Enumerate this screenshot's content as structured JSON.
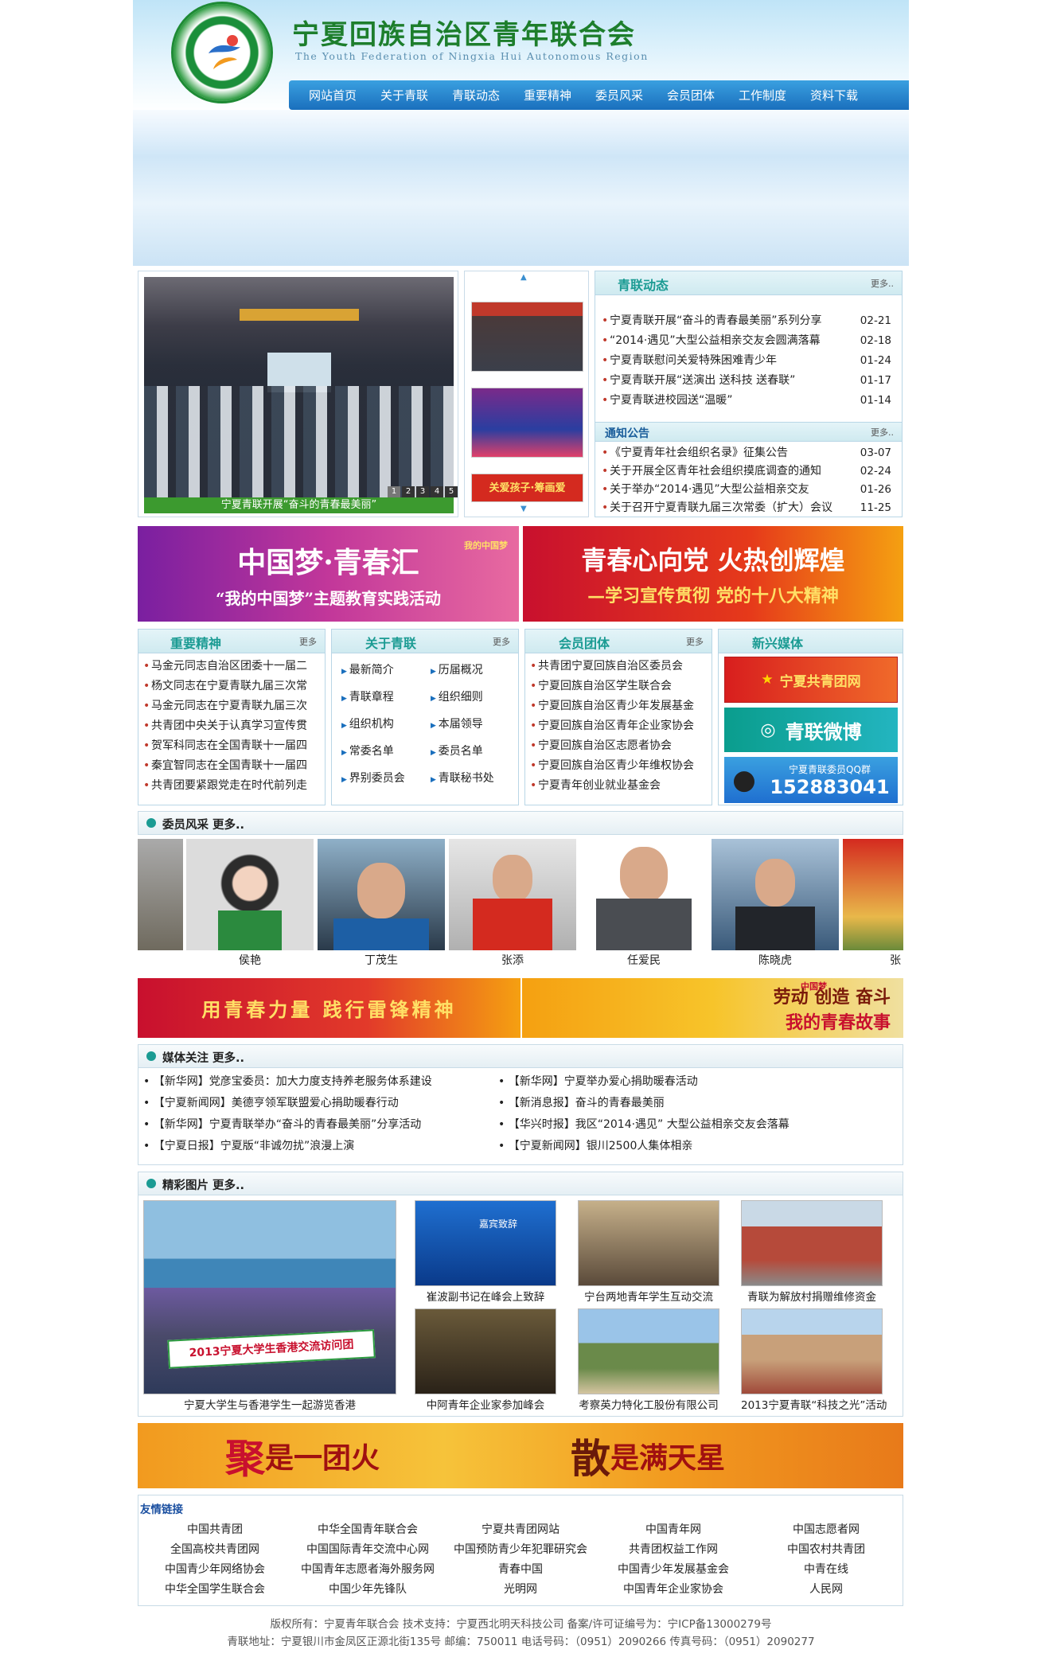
{
  "header": {
    "title": "宁夏回族自治区青年联合会",
    "subtitle": "The Youth Federation of Ningxia Hui Autonomous Region"
  },
  "nav": [
    "网站首页",
    "关于青联",
    "青联动态",
    "重要精神",
    "委员风采",
    "会员团体",
    "工作制度",
    "资料下载"
  ],
  "slider": {
    "caption": "宁夏青联开展“奋斗的青春最美丽”",
    "dots": [
      "1",
      "2",
      "3",
      "4",
      "5"
    ],
    "thumb_banner": "关爱孩子·筹画爱"
  },
  "news": {
    "title": "青联动态",
    "more": "更多..",
    "items": [
      {
        "text": "宁夏青联开展“奋斗的青春最美丽”系列分享",
        "date": "02-21"
      },
      {
        "text": "“2014·遇见”大型公益相亲交友会圆满落幕",
        "date": "02-18"
      },
      {
        "text": "宁夏青联慰问关爱特殊困难青少年",
        "date": "01-24"
      },
      {
        "text": "宁夏青联开展“送演出 送科技 送春联”",
        "date": "01-17"
      },
      {
        "text": "宁夏青联进校园送“温暖”",
        "date": "01-14"
      }
    ]
  },
  "notice": {
    "title": "通知公告",
    "more": "更多..",
    "items": [
      {
        "text": "《宁夏青年社会组织名录》征集公告",
        "date": "03-07"
      },
      {
        "text": "关于开展全区青年社会组织摸底调查的通知",
        "date": "02-24"
      },
      {
        "text": "关于举办“2014·遇见”大型公益相亲交友",
        "date": "01-26"
      },
      {
        "text": "关于召开宁夏青联九届三次常委（扩大）会议",
        "date": "11-25"
      }
    ]
  },
  "banners": {
    "left": {
      "line1": "中国梦·青春汇",
      "line2": "“我的中国梦”主题教育实践活动",
      "tag": "我的中国梦"
    },
    "right": {
      "line1": "青春心向党  火热创辉煌",
      "line2": "—学习宣传贯彻 党的十八大精神"
    }
  },
  "spirit": {
    "title": "重要精神",
    "more": "更多",
    "items": [
      "马金元同志自治区团委十一届二",
      "杨文同志在宁夏青联九届三次常",
      "马金元同志在宁夏青联九届三次",
      "共青团中央关于认真学习宣传贯",
      "贺军科同志在全国青联十一届四",
      "秦宜智同志在全国青联十一届四",
      "共青团要紧跟党走在时代前列走"
    ]
  },
  "about": {
    "title": "关于青联",
    "more": "更多",
    "left": [
      "最新简介",
      "青联章程",
      "组织机构",
      "常委名单",
      "界别委员会"
    ],
    "right": [
      "历届概况",
      "组织细则",
      "本届领导",
      "委员名单",
      "青联秘书处"
    ]
  },
  "members_group": {
    "title": "会员团体",
    "more": "更多",
    "items": [
      "共青团宁夏回族自治区委员会",
      "宁夏回族自治区学生联合会",
      "宁夏回族自治区青少年发展基金",
      "宁夏回族自治区青年企业家协会",
      "宁夏回族自治区志愿者协会",
      "宁夏回族自治区青少年维权协会",
      "宁夏青年创业就业基金会"
    ]
  },
  "new_media": {
    "title": "新兴媒体",
    "items": [
      {
        "label": "宁夏共青团网"
      },
      {
        "label": "青联微博"
      },
      {
        "label": "宁夏青联委员QQ群",
        "number": "152883041"
      }
    ]
  },
  "member_showcase": {
    "title": "委员风采  更多..",
    "names": [
      "侯艳",
      "丁茂生",
      "张添",
      "任爱民",
      "陈晓虎",
      "张"
    ]
  },
  "banners2": {
    "left": {
      "text": "用青春力量  践行雷锋精神"
    },
    "right": {
      "small": "中国梦",
      "line1": "劳动 创造 奋斗",
      "line2": "我的青春故事"
    }
  },
  "media_focus": {
    "title": "媒体关注  更多..",
    "left": [
      "【新华网】党彦宝委员：加大力度支持养老服务体系建设",
      "【宁夏新闻网】美德亨领军联盟爱心捐助暖春行动",
      "【新华网】宁夏青联举办“奋斗的青春最美丽”分享活动",
      "【宁夏日报】宁夏版“非诚勿扰”浪漫上演"
    ],
    "right": [
      "【新华网】宁夏举办爱心捐助暖春活动",
      "【新消息报】奋斗的青春最美丽",
      "【华兴时报】我区“2014·遇见” 大型公益相亲交友会落幕",
      "【宁夏新闻网】银川2500人集体相亲"
    ]
  },
  "gallery": {
    "title": "精彩图片  更多..",
    "main_caption": "宁夏大学生与香港学生一起游览香港",
    "main_banner": "2013宁夏大学生香港交流访问团",
    "items": [
      "崔波副书记在峰会上致辞",
      "宁台两地青年学生互动交流",
      "青联为解放村捐赠维修资金",
      "中阿青年企业家参加峰会",
      "考察英力特化工股份有限公司",
      "2013宁夏青联“科技之光”活动"
    ],
    "screen_text": "嘉宾致辞"
  },
  "slogan": {
    "a1": "聚",
    "a2": "是一团火",
    "b1": "散",
    "b2": "是满天星"
  },
  "links": {
    "title": "友情链接",
    "items": [
      "中国共青团",
      "中华全国青年联合会",
      "宁夏共青团网站",
      "中国青年网",
      "中国志愿者网",
      "全国高校共青团网",
      "中国国际青年交流中心网",
      "中国预防青少年犯罪研究会",
      "共青团权益工作网",
      "中国农村共青团",
      "中国青少年网络协会",
      "中国青年志愿者海外服务网",
      "青春中国",
      "中国青少年发展基金会",
      "中青在线",
      "中华全国学生联合会",
      "中国少年先锋队",
      "光明网",
      "中国青年企业家协会",
      "人民网"
    ]
  },
  "footer": {
    "line1": "版权所有：宁夏青年联合会  技术支持：宁夏西北明天科技公司  备案/许可证编号为：宁ICP备13000279号",
    "line2": "青联地址：宁夏银川市金凤区正源北街135号  邮编：750011  电话号码：（0951）2090266  传真号码：（0951）2090277"
  },
  "colors": {
    "accent": "#1b9b93",
    "nav": "#1a6fbd",
    "brand": "#1d7e2c",
    "banner_red": "#c8102e",
    "banner_orange": "#f5a011"
  }
}
